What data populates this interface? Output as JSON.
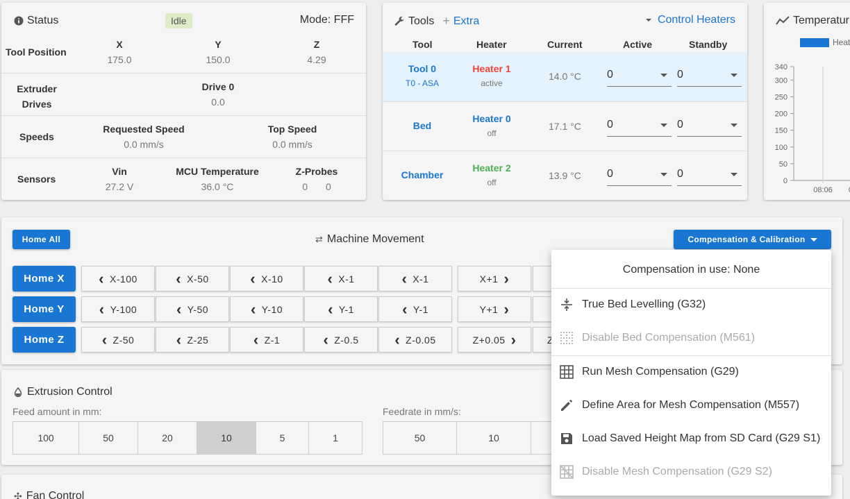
{
  "status": {
    "title": "Status",
    "state": "Idle",
    "mode": "Mode: FFF",
    "tool_position_label": "Tool Position",
    "axes": [
      {
        "name": "X",
        "value": "175.0"
      },
      {
        "name": "Y",
        "value": "150.0"
      },
      {
        "name": "Z",
        "value": "4.29"
      }
    ],
    "extruder_label_1": "Extruder",
    "extruder_label_2": "Drives",
    "drive_name": "Drive 0",
    "drive_value": "0.0",
    "speeds_label": "Speeds",
    "requested_speed_label": "Requested Speed",
    "requested_speed_value": "0.0 mm/s",
    "top_speed_label": "Top Speed",
    "top_speed_value": "0.0 mm/s",
    "sensors_label": "Sensors",
    "vin_label": "Vin",
    "vin_value": "27.2 V",
    "mcu_label": "MCU Temperature",
    "mcu_value": "36.0 °C",
    "zprobes_label": "Z-Probes",
    "zprobe_values": [
      "0",
      "0"
    ]
  },
  "tools": {
    "title": "Tools",
    "extra": "Extra",
    "control_heaters": "Control Heaters",
    "headers": [
      "Tool",
      "Heater",
      "Current",
      "Active",
      "Standby"
    ],
    "rows": [
      {
        "tool": "Tool 0",
        "tool_sub": "T0 - ASA",
        "heater": "Heater 1",
        "heater_state": "active",
        "heater_color": "#f44336",
        "current": "14.0 °C",
        "active": "0",
        "standby": "0"
      },
      {
        "tool": "Bed",
        "tool_sub": "",
        "heater": "Heater 0",
        "heater_state": "off",
        "heater_color": "#1976d2",
        "current": "17.1 °C",
        "active": "0",
        "standby": "0"
      },
      {
        "tool": "Chamber",
        "tool_sub": "",
        "heater": "Heater 2",
        "heater_state": "off",
        "heater_color": "#4caf50",
        "current": "13.9 °C",
        "active": "0",
        "standby": "0"
      }
    ]
  },
  "temperature_chart": {
    "title": "Temperatur",
    "legend": "Heat",
    "y_ticks": [
      "340",
      "300",
      "250",
      "200",
      "150",
      "100",
      "50",
      "0"
    ],
    "x_ticks": [
      "08:06",
      "08"
    ]
  },
  "movement": {
    "home_all": "Home All",
    "title": "Machine Movement",
    "compensation_button": "Compensation & Calibration",
    "rows": [
      {
        "home": "Home X",
        "buttons": [
          "X-100",
          "X-50",
          "X-10",
          "X-1",
          "X-1",
          "X+1"
        ],
        "dirs": [
          "l",
          "l",
          "l",
          "l",
          "l",
          "r"
        ]
      },
      {
        "home": "Home Y",
        "buttons": [
          "Y-100",
          "Y-50",
          "Y-10",
          "Y-1",
          "Y-1",
          "Y+1"
        ],
        "dirs": [
          "l",
          "l",
          "l",
          "l",
          "l",
          "r"
        ]
      },
      {
        "home": "Home Z",
        "buttons": [
          "Z-50",
          "Z-25",
          "Z-1",
          "Z-0.5",
          "Z-0.05",
          "Z+0.05"
        ],
        "dirs": [
          "l",
          "l",
          "l",
          "l",
          "l",
          "r"
        ]
      }
    ],
    "z_partial": "Z"
  },
  "compensation_menu": {
    "header": "Compensation in use: None",
    "items": [
      {
        "label": "True Bed Levelling (G32)",
        "icon": "align-vertical-center-icon",
        "disabled": false
      },
      {
        "label": "Disable Bed Compensation (M561)",
        "icon": "border-none-icon",
        "disabled": true
      },
      {
        "label": "Run Mesh Compensation (G29)",
        "icon": "grid-icon",
        "disabled": false
      },
      {
        "label": "Define Area for Mesh Compensation (M557)",
        "icon": "pencil-icon",
        "disabled": false
      },
      {
        "label": "Load Saved Height Map from SD Card (G29 S1)",
        "icon": "floppy-icon",
        "disabled": false
      },
      {
        "label": "Disable Mesh Compensation (G29 S2)",
        "icon": "grid-off-icon",
        "disabled": true
      }
    ]
  },
  "extrusion": {
    "title": "Extrusion Control",
    "feed_label": "Feed amount in mm:",
    "feed_options": [
      "100",
      "50",
      "20",
      "10",
      "5",
      "1"
    ],
    "feed_selected": "10",
    "feedrate_label": "Feedrate in mm/s:",
    "feedrate_options": [
      "50",
      "10"
    ]
  },
  "fan": {
    "title": "Fan Control"
  },
  "colors": {
    "primary": "#1976d2",
    "active_row": "#e3f2fd",
    "idle_badge": "#dcedc8"
  }
}
